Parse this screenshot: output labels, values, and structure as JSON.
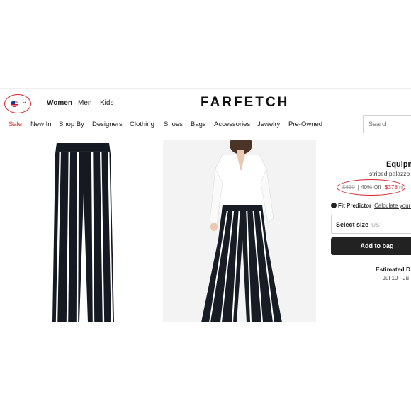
{
  "header": {
    "logo": "FARFETCH",
    "gender_tabs": [
      "Women",
      "Men",
      "Kids"
    ],
    "locale_chevron": "⌄"
  },
  "nav": {
    "items": [
      "Sale",
      "New In",
      "Shop By",
      "Designers",
      "Clothing",
      "Shoes",
      "Bags",
      "Accessories",
      "Jewelry",
      "Pre-Owned"
    ],
    "sale_color": "#e8322d"
  },
  "search": {
    "placeholder": "Search"
  },
  "product": {
    "brand": "Equipm",
    "name": "striped palazzo",
    "old_price": "$630",
    "discount": "| 40% Off",
    "new_price": "$378",
    "price_suffix": "m",
    "fit_predictor": "Fit Predictor",
    "fit_link": "Calculate your s",
    "size_label": "Select size",
    "size_region": "US",
    "add_to_bag": "Add to bag",
    "estimated_label": "Estimated D",
    "estimated_dates": "Jul 10 - Ju"
  },
  "annotations": {
    "circle_color": "#d6232e"
  }
}
